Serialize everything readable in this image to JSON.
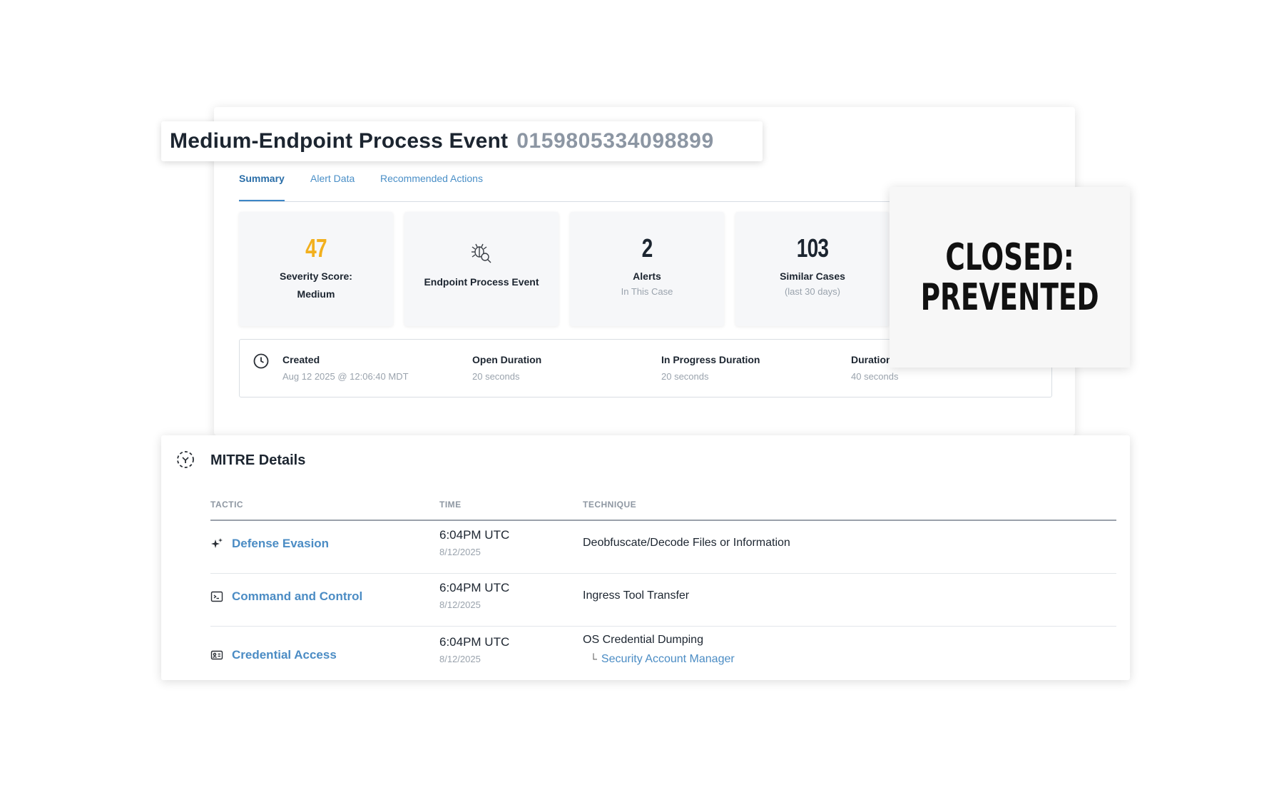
{
  "header": {
    "title": "Medium-Endpoint Process Event",
    "case_id": "0159805334098899"
  },
  "tabs": [
    {
      "label": "Summary",
      "active": true
    },
    {
      "label": "Alert Data",
      "active": false
    },
    {
      "label": "Recommended Actions",
      "active": false
    }
  ],
  "stats": {
    "severity": {
      "value": "47",
      "label": "Severity Score: Medium",
      "color": "#f2b01e"
    },
    "event_type": {
      "label": "Endpoint Process Event",
      "icon": "bug-search-icon"
    },
    "alerts": {
      "value": "2",
      "label": "Alerts",
      "sub": "In This Case"
    },
    "similar": {
      "value": "103",
      "label": "Similar Cases",
      "sub": "(last 30 days)"
    }
  },
  "status_overlay": {
    "line1": "CLOSED:",
    "line2": "PREVENTED"
  },
  "timeline": {
    "icon": "clock-icon",
    "created": {
      "label": "Created",
      "value": "Aug 12 2025 @ 12:06:40 MDT"
    },
    "open_duration": {
      "label": "Open Duration",
      "value": "20 seconds"
    },
    "in_progress_duration": {
      "label": "In Progress Duration",
      "value": "20 seconds"
    },
    "duration": {
      "label": "Duration",
      "value": "40 seconds"
    }
  },
  "mitre": {
    "title": "MITRE Details",
    "icon": "mitre-target-icon",
    "columns": {
      "tactic": "TACTIC",
      "time": "TIME",
      "technique": "TECHNIQUE"
    },
    "rows": [
      {
        "tactic": "Defense Evasion",
        "icon": "sparkle-icon",
        "time": "6:04PM UTC",
        "date": "8/12/2025",
        "technique": "Deobfuscate/Decode Files or Information",
        "sub_technique": ""
      },
      {
        "tactic": "Command and Control",
        "icon": "terminal-icon",
        "time": "6:04PM UTC",
        "date": "8/12/2025",
        "technique": "Ingress Tool Transfer",
        "sub_technique": ""
      },
      {
        "tactic": "Credential Access",
        "icon": "id-card-icon",
        "time": "6:04PM UTC",
        "date": "8/12/2025",
        "technique": "OS Credential Dumping",
        "sub_technique": "Security Account Manager"
      }
    ]
  }
}
